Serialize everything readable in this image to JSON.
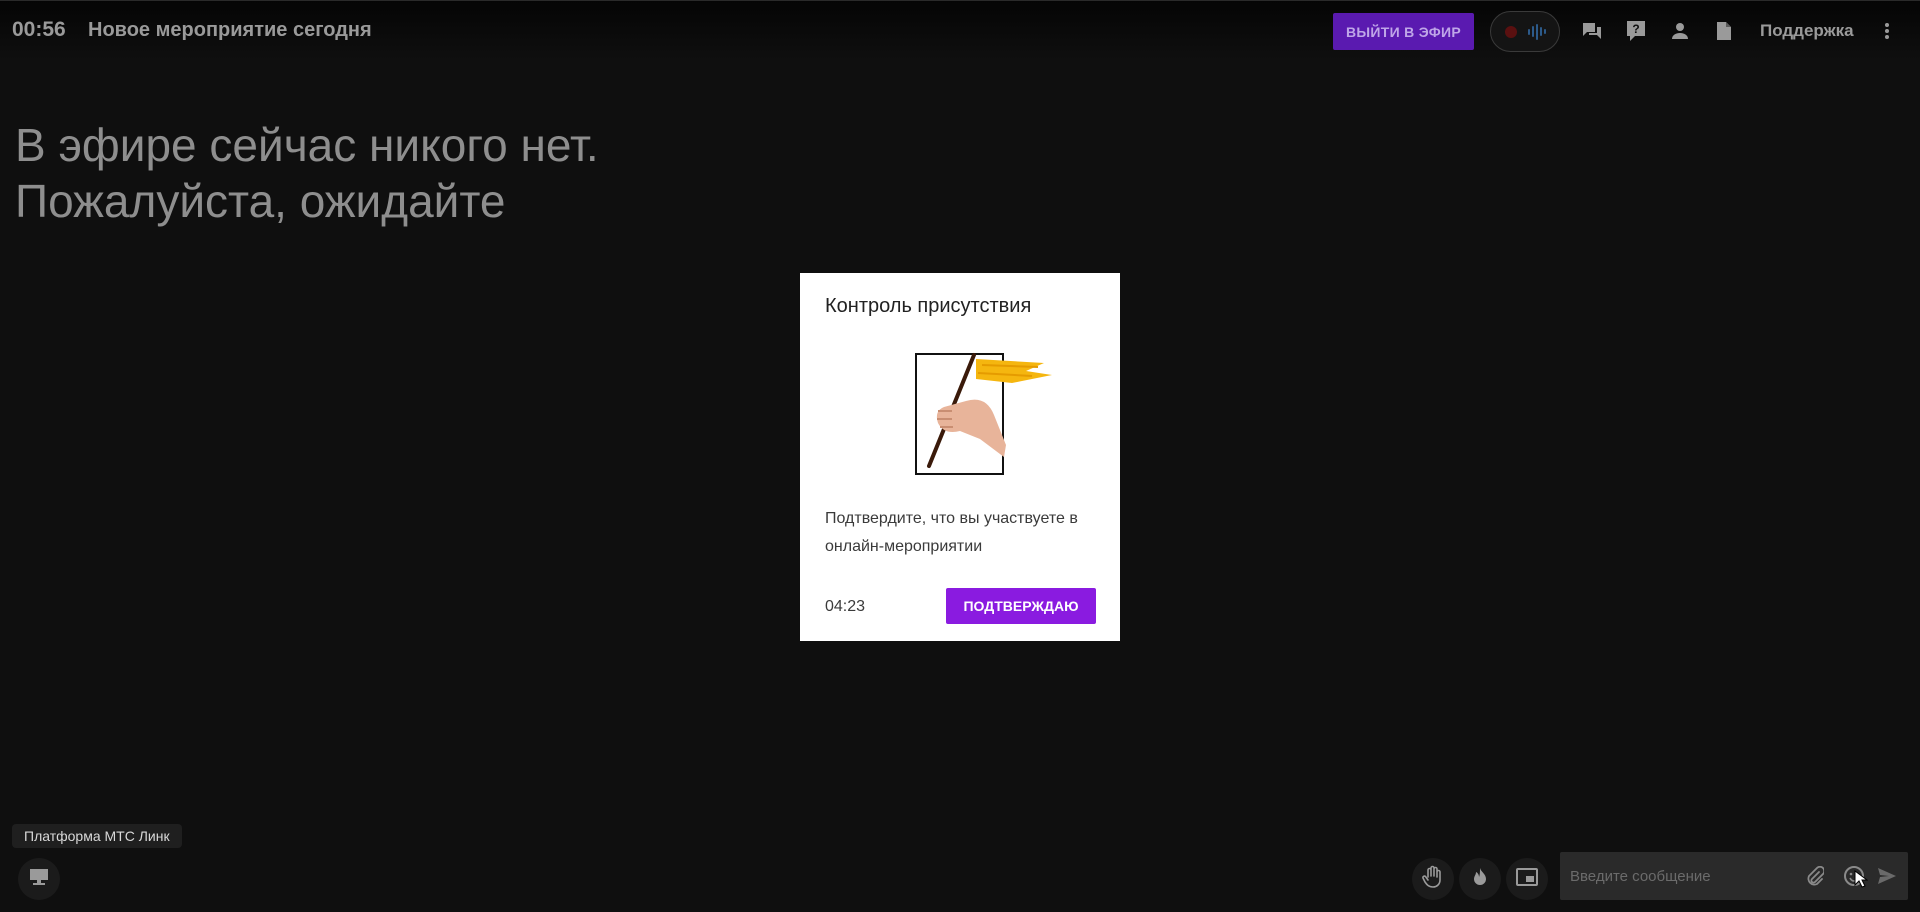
{
  "header": {
    "elapsed_time": "00:56",
    "event_title": "Новое мероприятие сегодня",
    "go_live_label": "ВЫЙТИ В ЭФИР",
    "support_label": "Поддержка"
  },
  "stage": {
    "waiting_line1": "В эфире сейчас никого нет.",
    "waiting_line2": "Пожалуйста, ожидайте"
  },
  "modal": {
    "title": "Контроль присутствия",
    "message": "Подтвердите, что вы участвуете в онлайн-мероприятии",
    "countdown": "04:23",
    "confirm_label": "ПОДТВЕРЖДАЮ"
  },
  "footer": {
    "tooltip": "Платформа МТС Линк",
    "chat_placeholder": "Введите сообщение"
  },
  "colors": {
    "background": "#0f0f0f",
    "brand_purple": "#8a1be0",
    "go_live_bg": "#5a1ab0",
    "flag_yellow": "#f5b60f"
  },
  "icons": [
    "chat-icon",
    "question-icon",
    "person-icon",
    "document-icon",
    "more-vert-icon",
    "screen-icon",
    "hand-icon",
    "fire-icon",
    "pip-icon",
    "attach-icon",
    "emoji-icon",
    "send-icon"
  ]
}
